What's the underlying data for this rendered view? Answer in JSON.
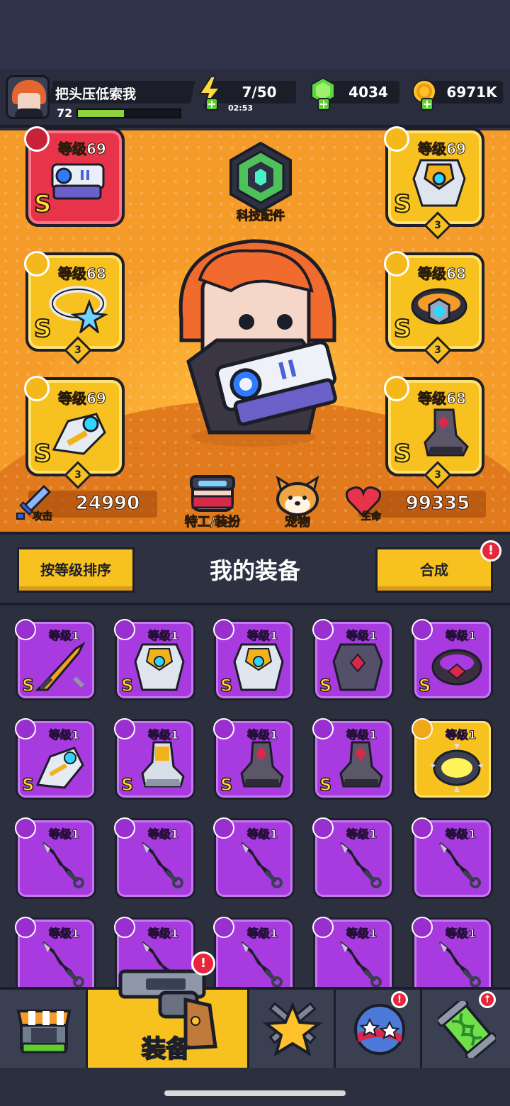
{
  "player": {
    "name": "把头压低索我",
    "level": "72",
    "xp_fraction": 0.45
  },
  "resources": {
    "energy": "7/50",
    "energy_timer": "02:53",
    "gems": "4034",
    "gold": "6971K"
  },
  "equipped": [
    {
      "slot": "weapon",
      "level": "等级69",
      "rank": "S",
      "stars": "",
      "color": "red"
    },
    {
      "slot": "armor",
      "level": "等级69",
      "rank": "S",
      "stars": "3",
      "color": "gold"
    },
    {
      "slot": "necklace",
      "level": "等级68",
      "rank": "S",
      "stars": "3",
      "color": "gold"
    },
    {
      "slot": "belt",
      "level": "等级68",
      "rank": "S",
      "stars": "3",
      "color": "gold"
    },
    {
      "slot": "glove",
      "level": "等级69",
      "rank": "S",
      "stars": "3",
      "color": "gold"
    },
    {
      "slot": "boots",
      "level": "等级68",
      "rank": "S",
      "stars": "3",
      "color": "gold"
    }
  ],
  "hero": {
    "tech_label": "科技配件",
    "attack_label": "攻击",
    "attack": "24990",
    "agent_label": "特工/装扮",
    "pet_label": "宠物",
    "hp_label": "生命",
    "hp": "99335"
  },
  "section": {
    "sort_button": "按等级排序",
    "title": "我的装备",
    "merge_button": "合成",
    "merge_alert": "!"
  },
  "inventory": [
    {
      "slot": "weapon",
      "level": "等级1",
      "rank": "S",
      "art": "sword"
    },
    {
      "slot": "armor",
      "level": "等级1",
      "rank": "S",
      "art": "mech-armor"
    },
    {
      "slot": "armor",
      "level": "等级1",
      "rank": "S",
      "art": "mech-armor"
    },
    {
      "slot": "armor",
      "level": "等级1",
      "rank": "S",
      "art": "dark-armor"
    },
    {
      "slot": "belt",
      "level": "等级1",
      "rank": "S",
      "art": "dark-belt"
    },
    {
      "slot": "glove",
      "level": "等级1",
      "rank": "S",
      "art": "gauntlet"
    },
    {
      "slot": "boots",
      "level": "等级1",
      "rank": "S",
      "art": "gold-boots"
    },
    {
      "slot": "boots",
      "level": "等级1",
      "rank": "S",
      "art": "dark-boots"
    },
    {
      "slot": "boots",
      "level": "等级1",
      "rank": "S",
      "art": "dark-boots"
    },
    {
      "slot": "necklace",
      "level": "等级1",
      "rank": "",
      "art": "spike-ring",
      "gold": true
    },
    {
      "slot": "weapon",
      "level": "等级1",
      "rank": "",
      "art": "kunai"
    },
    {
      "slot": "weapon",
      "level": "等级1",
      "rank": "",
      "art": "kunai"
    },
    {
      "slot": "weapon",
      "level": "等级1",
      "rank": "",
      "art": "kunai"
    },
    {
      "slot": "weapon",
      "level": "等级1",
      "rank": "",
      "art": "kunai"
    },
    {
      "slot": "weapon",
      "level": "等级1",
      "rank": "",
      "art": "kunai"
    },
    {
      "slot": "weapon",
      "level": "等级1",
      "rank": "",
      "art": "kunai"
    },
    {
      "slot": "weapon",
      "level": "等级1",
      "rank": "",
      "art": "kunai"
    },
    {
      "slot": "weapon",
      "level": "等级1",
      "rank": "",
      "art": "kunai"
    },
    {
      "slot": "weapon",
      "level": "等级1",
      "rank": "",
      "art": "kunai"
    },
    {
      "slot": "weapon",
      "level": "等级1",
      "rank": "",
      "art": "kunai"
    }
  ],
  "nav": {
    "items": [
      "shop-icon",
      "revolver-icon",
      "battle-star-icon",
      "star-ball-icon",
      "dna-capsule-icon"
    ],
    "active_label": "装备",
    "equip_alert": "!",
    "talent_alert": "!",
    "lab_badge": "↑"
  },
  "colors": {
    "hero_bg": "#f59b2a",
    "epic_purple": "#a83be0",
    "legendary_gold": "#f7c21f",
    "red_card": "#e8344a",
    "alert_red": "#e8263b"
  }
}
